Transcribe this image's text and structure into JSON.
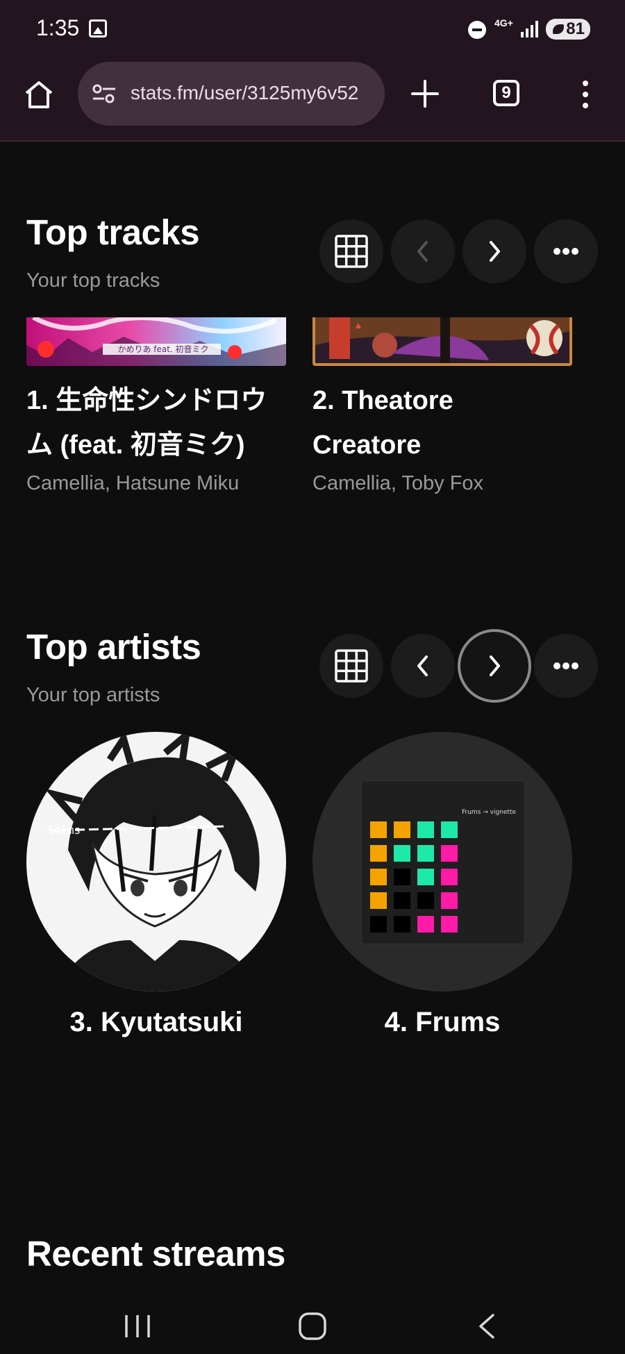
{
  "status_bar": {
    "time": "1:35",
    "network": "4G+",
    "battery": "81"
  },
  "browser": {
    "url": "stats.fm/user/3125my6v52",
    "tab_count": "9"
  },
  "top_tracks": {
    "title": "Top tracks",
    "subtitle": "Your top tracks",
    "tracks": [
      {
        "title": "1. 生命性シンドロウム (feat. 初音ミク)",
        "artists": "Camellia, Hatsune Miku",
        "art_caption": "かめりあ feat. 初音ミク"
      },
      {
        "title": "2. Theatore Creatore",
        "artists": "Camellia, Toby Fox"
      }
    ]
  },
  "top_artists": {
    "title": "Top artists",
    "subtitle": "Your top artists",
    "artists": [
      {
        "name": "3. Kyutatsuki",
        "art_text": "141ms"
      },
      {
        "name": "4. Frums",
        "art_text": "Frums → vignette"
      }
    ]
  },
  "recent_streams": {
    "title": "Recent streams"
  },
  "icons": {
    "home": "home-icon",
    "site_settings": "tune-icon",
    "new_tab": "plus-icon",
    "tabs": "tab-switcher-icon",
    "menu": "more-vert-icon",
    "grid": "grid-icon",
    "prev": "chevron-left-icon",
    "next": "chevron-right-icon",
    "more": "more-horiz-icon"
  },
  "colors": {
    "background": "#0e0e0e",
    "chrome": "#231520",
    "urlbar": "#43303e",
    "muted_text": "#9a9a9a",
    "frums_orange": "#f5a300",
    "frums_green": "#1de9a8",
    "frums_pink": "#ff1aa8"
  }
}
